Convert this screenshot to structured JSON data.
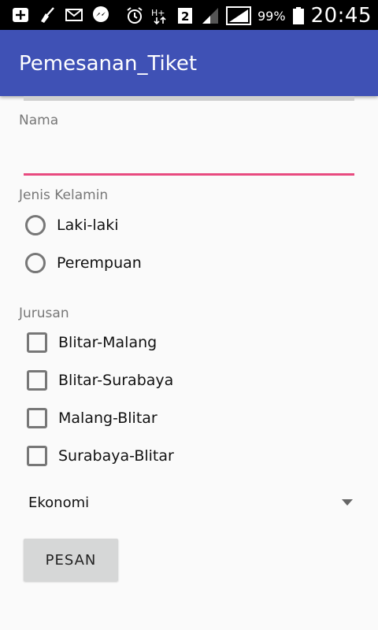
{
  "status_bar": {
    "icons": [
      "add-box-icon",
      "broom-icon",
      "mail-icon",
      "messenger-icon",
      "alarm-icon",
      "h-plus-network-icon",
      "sim-2-icon",
      "signal-icon",
      "signal-icon",
      "battery-icon"
    ],
    "battery_percent": "99%",
    "time": "20:45"
  },
  "app_bar": {
    "title": "Pemesanan_Tiket",
    "color": "#3f51b5"
  },
  "form": {
    "name_label": "Nama",
    "name_value": "",
    "gender_label": "Jenis Kelamin",
    "gender_options": [
      "Laki-laki",
      "Perempuan"
    ],
    "route_label": "Jurusan",
    "route_options": [
      "Blitar-Malang",
      "Blitar-Surabaya",
      "Malang-Blitar",
      "Surabaya-Blitar"
    ],
    "class_selected": "Ekonomi",
    "submit_label": "PESAN",
    "accent_color": "#e84a7f"
  }
}
